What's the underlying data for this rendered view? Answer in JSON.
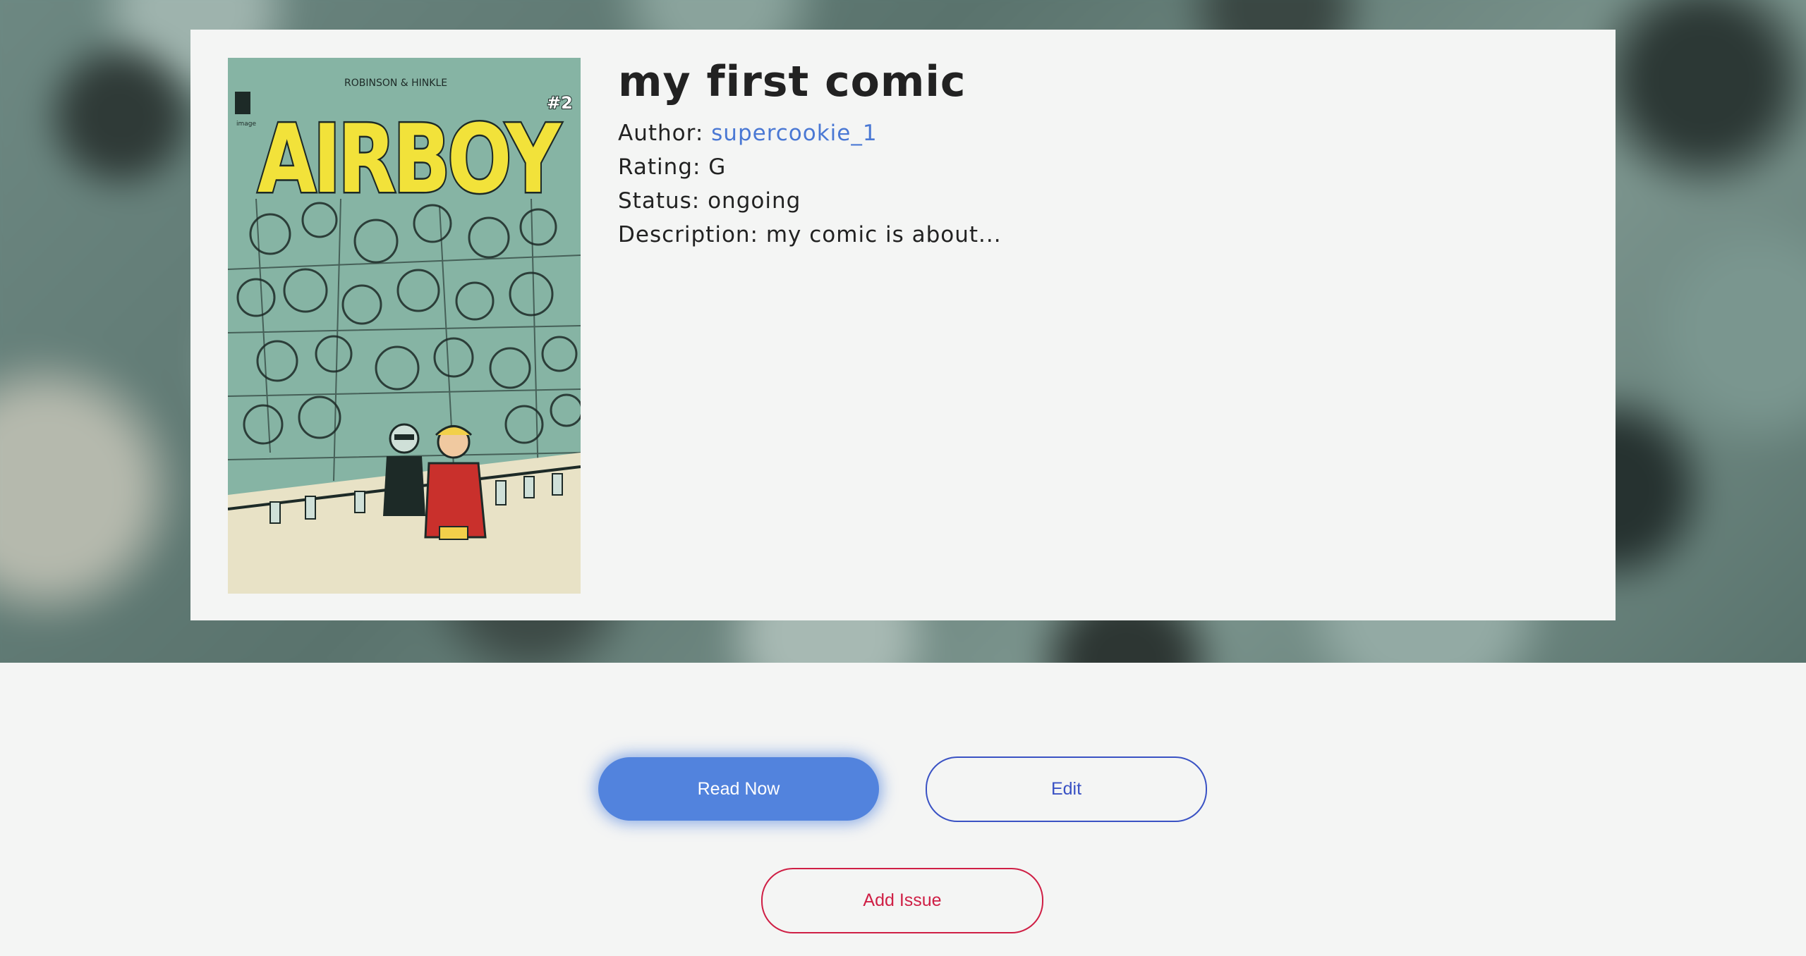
{
  "comic": {
    "title": "my first comic",
    "author_label": "Author:",
    "author_value": "supercookie_1",
    "rating_label": "Rating:",
    "rating_value": "G",
    "status_label": "Status:",
    "status_value": "ongoing",
    "description_label": "Description:",
    "description_value": "my comic is about..."
  },
  "cover": {
    "title_text": "AIRBOY",
    "credits_text": "ROBINSON & HINKLE",
    "issue_text": "#2",
    "publisher_text": "image",
    "colors": {
      "background": "#86b4a4",
      "title": "#f2e23a",
      "ink": "#1d2a27"
    }
  },
  "actions": {
    "read_now_label": "Read Now",
    "edit_label": "Edit",
    "add_issue_label": "Add Issue"
  },
  "colors": {
    "accent_blue": "#5283dd",
    "edit_blue": "#3a52c4",
    "danger_red": "#cf1f45",
    "link_blue": "#4a78d4",
    "page_background": "#f4f5f4"
  }
}
